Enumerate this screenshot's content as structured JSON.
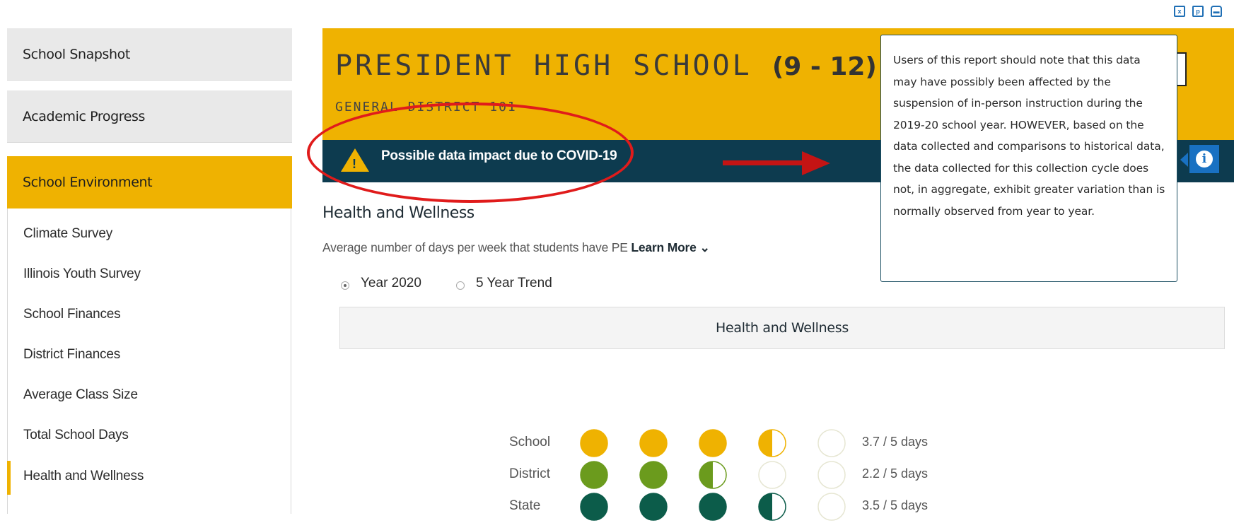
{
  "sidebar": {
    "sections": [
      "School Snapshot",
      "Academic Progress",
      "School Environment"
    ],
    "items": [
      "Climate Survey",
      "Illinois Youth Survey",
      "School Finances",
      "District Finances",
      "Average Class Size",
      "Total School Days",
      "Health and Wellness"
    ]
  },
  "header": {
    "school_name": "PRESIDENT HIGH SCHOOL",
    "grades": "(9 - 12)",
    "district": "GENERAL DISTRICT 101"
  },
  "alert": {
    "text": "Possible data impact due to COVID-19",
    "tooltip": "Users of this report should note that this data may have possibly been affected by the suspension of in-person instruction during the 2019-20 school year. HOWEVER, based on the data collected and comparisons to historical data, the data collected for this collection cycle does not, in aggregate, exhibit greater variation than is normally observed from year to year."
  },
  "section": {
    "title": "Health and Wellness",
    "description": "Average number of days per week that students have PE",
    "learn_more": "Learn More",
    "radio_options": [
      "Year 2020",
      "5 Year Trend"
    ],
    "selected_option": "Year 2020"
  },
  "chart_data": {
    "type": "table",
    "title": "Health and Wellness",
    "max_days": 5,
    "rows": [
      {
        "label": "School",
        "value": 3.7,
        "text": "3.7 / 5 days",
        "color": "#efb201"
      },
      {
        "label": "District",
        "value": 2.2,
        "text": "2.2 / 5 days",
        "color": "#6b9b1d"
      },
      {
        "label": "State",
        "value": 3.5,
        "text": "3.5 / 5 days",
        "color": "#0c5c4a"
      }
    ]
  },
  "icons": [
    "export-excel-icon",
    "export-pdf-icon",
    "print-icon",
    "warning-icon",
    "info-icon"
  ]
}
